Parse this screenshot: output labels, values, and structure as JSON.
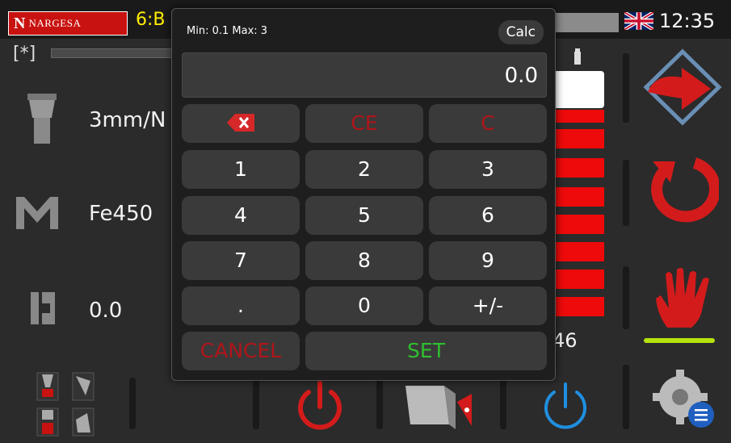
{
  "header": {
    "logo_text": "NARGESA",
    "logo_letter": "N",
    "program_label": "6:B",
    "clock": "12:35",
    "flag_icon": "uk-flag-icon"
  },
  "left_panel": {
    "tag": "[*]",
    "tool_value": "3mm/N",
    "material_value": "Fe450",
    "length_value": "0.0"
  },
  "meter": {
    "value_text": "46",
    "color": "#ee0a0a"
  },
  "calculator": {
    "range_text": "Min: 0.1 Max: 3",
    "mode_button": "Calc",
    "display_value": "0.0",
    "keys": {
      "ce": "CE",
      "c": "C",
      "k1": "1",
      "k2": "2",
      "k3": "3",
      "k4": "4",
      "k5": "5",
      "k6": "6",
      "k7": "7",
      "k8": "8",
      "k9": "9",
      "dot": ".",
      "k0": "0",
      "sign": "+/-",
      "cancel": "CANCEL",
      "set": "SET"
    }
  },
  "colors": {
    "accent_red": "#c8120f",
    "set_green": "#2fbf2f",
    "indicator_green": "#b5e10f",
    "power_blue": "#1f8fe0"
  }
}
